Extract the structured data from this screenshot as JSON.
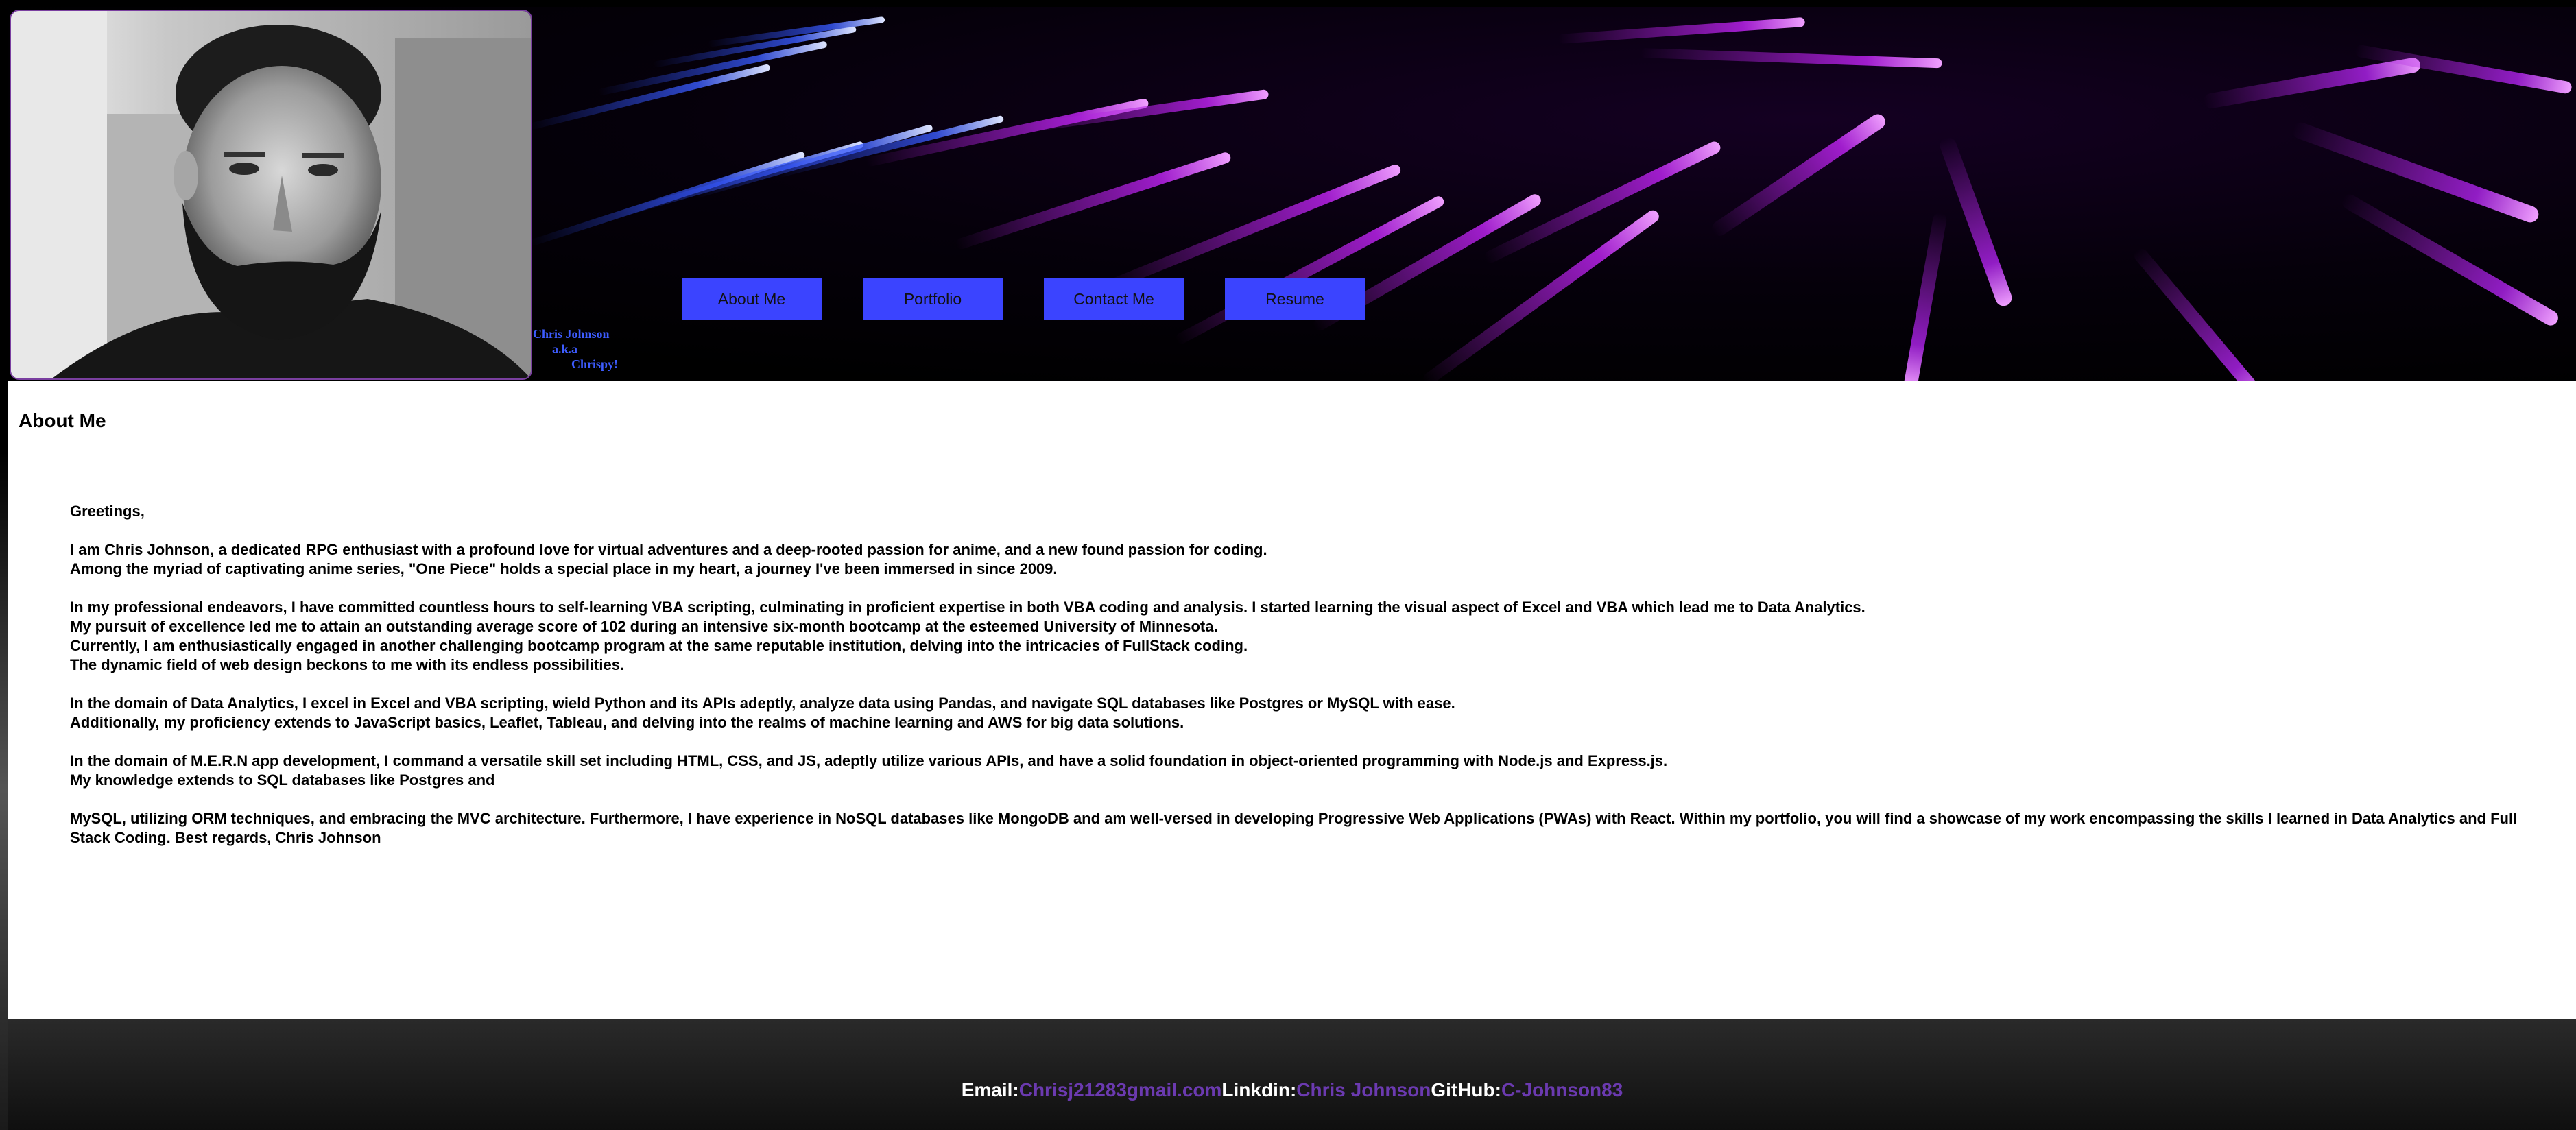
{
  "header": {
    "caption_lines": [
      "Chris Johnson",
      "a.k.a",
      "Chrispy!"
    ],
    "nav": [
      "About Me",
      "Portfolio",
      "Contact Me",
      "Resume"
    ]
  },
  "about": {
    "title": "About Me",
    "paragraphs": [
      [
        "Greetings,"
      ],
      [
        "I am Chris Johnson, a dedicated RPG enthusiast with a profound love for virtual adventures and a deep-rooted passion for anime, and a new found passion for coding.",
        "Among the myriad of captivating anime series, \"One Piece\" holds a special place in my heart, a journey I've been immersed in since 2009."
      ],
      [
        "In my professional endeavors, I have committed countless hours to self-learning VBA scripting, culminating in proficient expertise in both VBA coding and analysis. I started learning the visual aspect of Excel and VBA which lead me to Data Analytics.",
        "My pursuit of excellence led me to attain an outstanding average score of 102 during an intensive six-month bootcamp at the esteemed University of Minnesota.",
        "Currently, I am enthusiastically engaged in another challenging bootcamp program at the same reputable institution, delving into the intricacies of FullStack coding.",
        "The dynamic field of web design beckons to me with its endless possibilities."
      ],
      [
        "In the domain of Data Analytics, I excel in Excel and VBA scripting, wield Python and its APIs adeptly, analyze data using Pandas, and navigate SQL databases like Postgres or MySQL with ease.",
        "Additionally, my proficiency extends to JavaScript basics, Leaflet, Tableau, and delving into the realms of machine learning and AWS for big data solutions."
      ],
      [
        "In the domain of M.E.R.N app development, I command a versatile skill set including HTML, CSS, and JS, adeptly utilize various APIs, and have a solid foundation in object-oriented programming with Node.js and Express.js.",
        "My knowledge extends to SQL databases like Postgres and"
      ],
      [
        "MySQL, utilizing ORM techniques, and embracing the MVC architecture. Furthermore, I have experience in NoSQL databases like MongoDB and am well-versed in developing Progressive Web Applications (PWAs) with React. Within my portfolio, you will find a showcase of my work encompassing the skills I learned in Data Analytics and Full Stack Coding. Best regards, Chris Johnson"
      ]
    ]
  },
  "footer": {
    "email_label": "Email:",
    "email_value": "Chrisj21283gmail.com",
    "linkedin_label": "Linkdin:",
    "linkedin_value": "Chris Johnson",
    "github_label": "GitHub:",
    "github_value": "C-Johnson83"
  },
  "colors": {
    "nav_button": "#3b44ff",
    "caption": "#3d5cff",
    "footer_link": "#6b3ab0",
    "streak_purple": "#b020e0",
    "streak_blue": "#2a4cff"
  }
}
